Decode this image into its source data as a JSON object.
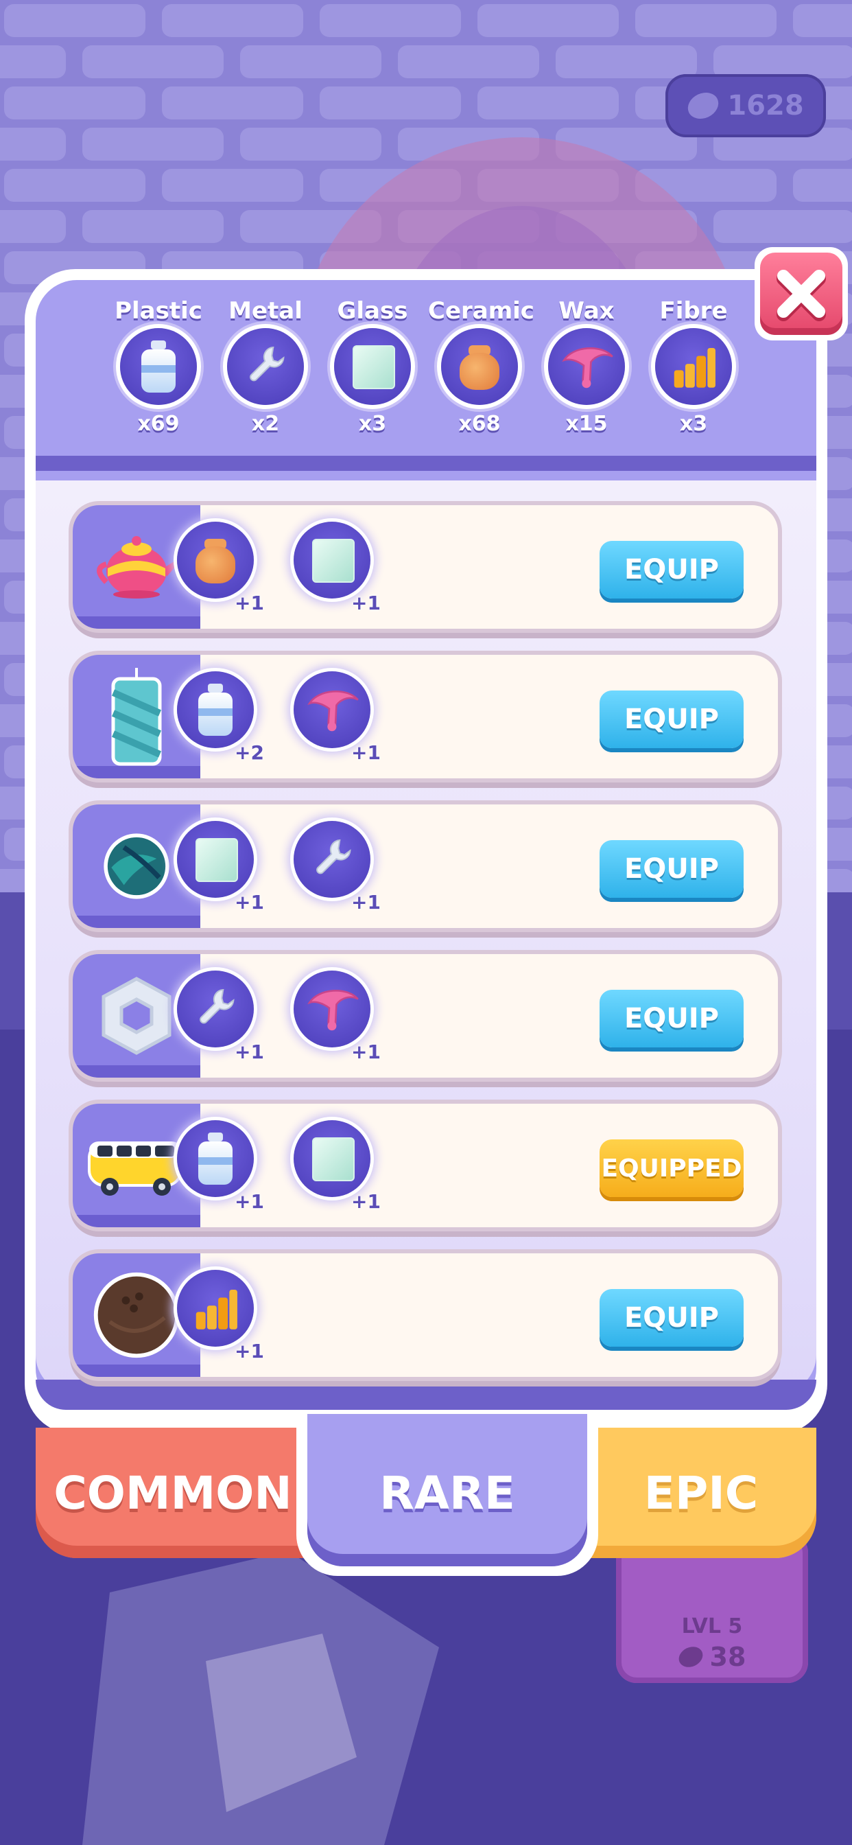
{
  "currency": {
    "amount": "1628",
    "icon": "pebble-icon"
  },
  "resources": [
    {
      "name": "Plastic",
      "count": "x69",
      "icon": "bottle-icon"
    },
    {
      "name": "Metal",
      "count": "x2",
      "icon": "wrench-icon"
    },
    {
      "name": "Glass",
      "count": "x3",
      "icon": "glass-icon"
    },
    {
      "name": "Ceramic",
      "count": "x68",
      "icon": "pot-icon"
    },
    {
      "name": "Wax",
      "count": "x15",
      "icon": "wax-icon"
    },
    {
      "name": "Fibre",
      "count": "x3",
      "icon": "fibre-icon"
    }
  ],
  "items": [
    {
      "thumb": "teapot-icon",
      "button": "EQUIP",
      "equipped": false,
      "materials": [
        {
          "icon": "pot-icon",
          "amount": "+1"
        },
        {
          "icon": "glass-icon",
          "amount": "+1"
        }
      ]
    },
    {
      "thumb": "candle-icon",
      "button": "EQUIP",
      "equipped": false,
      "materials": [
        {
          "icon": "bottle-icon",
          "amount": "+2"
        },
        {
          "icon": "wax-icon",
          "amount": "+1"
        }
      ]
    },
    {
      "thumb": "marble-icon",
      "button": "EQUIP",
      "equipped": false,
      "materials": [
        {
          "icon": "glass-icon",
          "amount": "+1"
        },
        {
          "icon": "wrench-icon",
          "amount": "+1"
        }
      ]
    },
    {
      "thumb": "hex-nut-icon",
      "button": "EQUIP",
      "equipped": false,
      "materials": [
        {
          "icon": "wrench-icon",
          "amount": "+1"
        },
        {
          "icon": "wax-icon",
          "amount": "+1"
        }
      ]
    },
    {
      "thumb": "bus-icon",
      "button": "EQUIPPED",
      "equipped": true,
      "materials": [
        {
          "icon": "bottle-icon",
          "amount": "+1"
        },
        {
          "icon": "glass-icon",
          "amount": "+1"
        }
      ]
    },
    {
      "thumb": "coconut-icon",
      "button": "EQUIP",
      "equipped": false,
      "materials": [
        {
          "icon": "fibre-icon",
          "amount": "+1"
        }
      ]
    }
  ],
  "tabs": {
    "common": "COMMON",
    "rare": "RARE",
    "epic": "EPIC",
    "active": "rare"
  },
  "background_card": {
    "level": "LVL 5",
    "cost": "38"
  },
  "colors": {
    "panel": "#a79ff0",
    "equip_button": "#3cbdf0",
    "equipped_button": "#f9b928",
    "tab_common": "#f47a6b",
    "tab_epic": "#ffc95e",
    "close": "#e4466a"
  }
}
